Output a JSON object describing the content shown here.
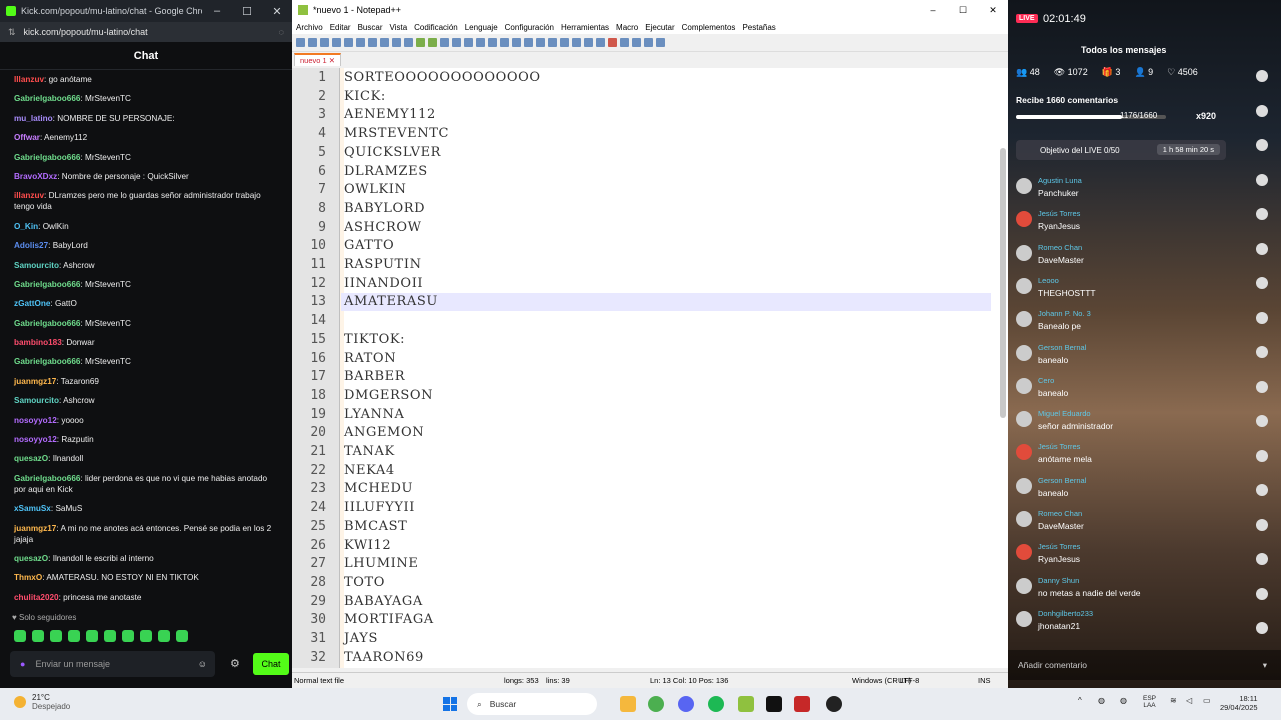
{
  "chrome": {
    "title": "Kick.com/popout/mu-latino/chat - Google Chrome",
    "url": "kick.com/popout/mu-latino/chat",
    "chat_title": "Chat",
    "messages": [
      {
        "user": "Illanzuv",
        "text": "go anótame",
        "color": "#ff4d4d"
      },
      {
        "user": "Gabrielgaboo666",
        "text": "MrStevenTC",
        "color": "#6fdc8c"
      },
      {
        "user": "mu_latino",
        "text": "NOMBRE DE SU PERSONAJE:",
        "color": "#a78bfa"
      },
      {
        "user": "Offwar",
        "text": "Aenemy112",
        "color": "#c77dff"
      },
      {
        "user": "Gabrielgaboo666",
        "text": "MrStevenTC",
        "color": "#6fdc8c"
      },
      {
        "user": "BravoXDxz",
        "text": "Nombre de personaje : QuickSilver",
        "color": "#b36cff"
      },
      {
        "user": "illanzuv",
        "text": "DLramzes pero me lo guardas señor administrador trabajo tengo vida",
        "color": "#ff4d4d"
      },
      {
        "user": "O_Kin",
        "text": "OwlKin",
        "color": "#4fc3f7"
      },
      {
        "user": "Adolis27",
        "text": "BabyLord",
        "color": "#5b8def"
      },
      {
        "user": "Samourcito",
        "text": "Ashcrow",
        "color": "#5fd3c3"
      },
      {
        "user": "Gabrielgaboo666",
        "text": "MrStevenTC",
        "color": "#6fdc8c"
      },
      {
        "user": "zGattOne",
        "text": "GattO",
        "color": "#4fc3f7"
      },
      {
        "user": "Gabrielgaboo666",
        "text": "MrStevenTC",
        "color": "#6fdc8c"
      },
      {
        "user": "bambino183",
        "text": "Donwar",
        "color": "#ff4d6d"
      },
      {
        "user": "Gabrielgaboo666",
        "text": "MrStevenTC",
        "color": "#6fdc8c"
      },
      {
        "user": "juanmgz17",
        "text": "Tazaron69",
        "color": "#ffb84d"
      },
      {
        "user": "Samourcito",
        "text": "Ashcrow",
        "color": "#5fd3c3"
      },
      {
        "user": "nosoyyo12",
        "text": "yoooo",
        "color": "#b36cff"
      },
      {
        "user": "nosoyyo12",
        "text": "Razputin",
        "color": "#b36cff"
      },
      {
        "user": "quesazO",
        "text": "Ilnandoll",
        "color": "#6fdc8c"
      },
      {
        "user": "Gabrielgaboo666",
        "text": "lider perdona es que no vi que me habias anotado por aqui en Kick",
        "color": "#6fdc8c"
      },
      {
        "user": "xSamuSx",
        "text": "SaMuS",
        "color": "#4fc3f7"
      },
      {
        "user": "juanmgz17",
        "text": "A mi no me anotes acá entonces. Pensé se podia en los 2 jajaja",
        "color": "#ffb84d"
      },
      {
        "user": "quesazO",
        "text": "Ilnandoll le escribi al interno",
        "color": "#6fdc8c"
      },
      {
        "user": "ThmxO",
        "text": "AMATERASU. NO ESTOY NI EN TIKTOK",
        "color": "#ffb84d"
      },
      {
        "user": "chulita2020",
        "text": "princesa me anotaste",
        "color": "#ff4d6d"
      }
    ],
    "followers_only": "Solo seguidores",
    "input_placeholder": "Enviar un mensaje",
    "chat_button": "Chat"
  },
  "notepad": {
    "title": "*nuevo 1 - Notepad++",
    "menu": [
      "Archivo",
      "Editar",
      "Buscar",
      "Vista",
      "Codificación",
      "Lenguaje",
      "Configuración",
      "Herramientas",
      "Macro",
      "Ejecutar",
      "Complementos",
      "Pestañas"
    ],
    "tab": "nuevo 1",
    "current_line": 13,
    "lines": [
      "SORTEOOOOOOOOOOOOO",
      "KICK:",
      "AENEMY112",
      "MRSTEVENTC",
      "QUICKSLVER",
      "DLRAMZES",
      "OWLKIN",
      "BABYLORD",
      "ASHCROW",
      "GATTO",
      "RASPUTIN",
      "IINANDOII",
      "AMATERASU",
      "",
      "TIKTOK:",
      "RATON",
      "BARBER",
      "DMGERSON",
      "LYANNA",
      "ANGEMON",
      "TANAK",
      "NEKA4",
      "MCHEDU",
      "IILUFYYII",
      "BMCAST",
      "KWI12",
      "LHUMINE",
      "TOTO",
      "BABAYAGA",
      "MORTIFAGA",
      "JAYS",
      "TAARON69"
    ],
    "status": {
      "type": "Normal text file",
      "length": "longs: 353",
      "lines": "lins: 39",
      "pos": "Ln: 13   Col: 10   Pos: 136",
      "eol": "Windows (CR LF)",
      "enc": "UTF-8",
      "ins": "INS"
    }
  },
  "tiktok": {
    "live_badge": "LIVE",
    "timer": "02:01:49",
    "all_messages": "Todos los mensajes",
    "stats": [
      "48",
      "1072",
      "3",
      "9",
      "4506"
    ],
    "recibe": "Recibe 1660 comentarios",
    "progress_text": "1176/1660",
    "progress_fraction": 0.708,
    "multiplier": "x920",
    "goal": "Objetivo del LIVE 0/50",
    "goal_time": "1 h 58 min 20 s",
    "comments": [
      {
        "name": "Agustin Luna",
        "text": "Panchuker",
        "red": false
      },
      {
        "name": "Jesús Torres",
        "text": "RyanJesus",
        "red": true
      },
      {
        "name": "Romeo Chan",
        "text": "DaveMaster",
        "red": false
      },
      {
        "name": "Leooo",
        "text": "THEGHOSTTT",
        "red": false
      },
      {
        "name": "Johann P.  No. 3",
        "text": "Banealo pe",
        "red": false
      },
      {
        "name": "Gerson Bernal",
        "text": "banealo",
        "red": false
      },
      {
        "name": "Cero",
        "text": "banealo",
        "red": false
      },
      {
        "name": "Miguel Eduardo",
        "text": "señor administrador",
        "red": false
      },
      {
        "name": "Jesús Torres",
        "text": "anótame mela",
        "red": true
      },
      {
        "name": "Gerson Bernal",
        "text": "banealo",
        "red": false
      },
      {
        "name": "Romeo Chan",
        "text": "DaveMaster",
        "red": false
      },
      {
        "name": "Jesús Torres",
        "text": "RyanJesus",
        "red": true
      },
      {
        "name": "Danny Shun",
        "text": "no metas a nadie del verde",
        "red": false
      },
      {
        "name": "Donhgilberto233",
        "text": "jhonatan21",
        "red": false
      }
    ],
    "add_comment": "Añadir comentario"
  },
  "taskbar": {
    "weather_temp": "21°C",
    "weather_desc": "Despejado",
    "search": "Buscar",
    "lang": "ESP",
    "lang2": "LAA",
    "time": "18:11",
    "date": "29/04/2025"
  }
}
